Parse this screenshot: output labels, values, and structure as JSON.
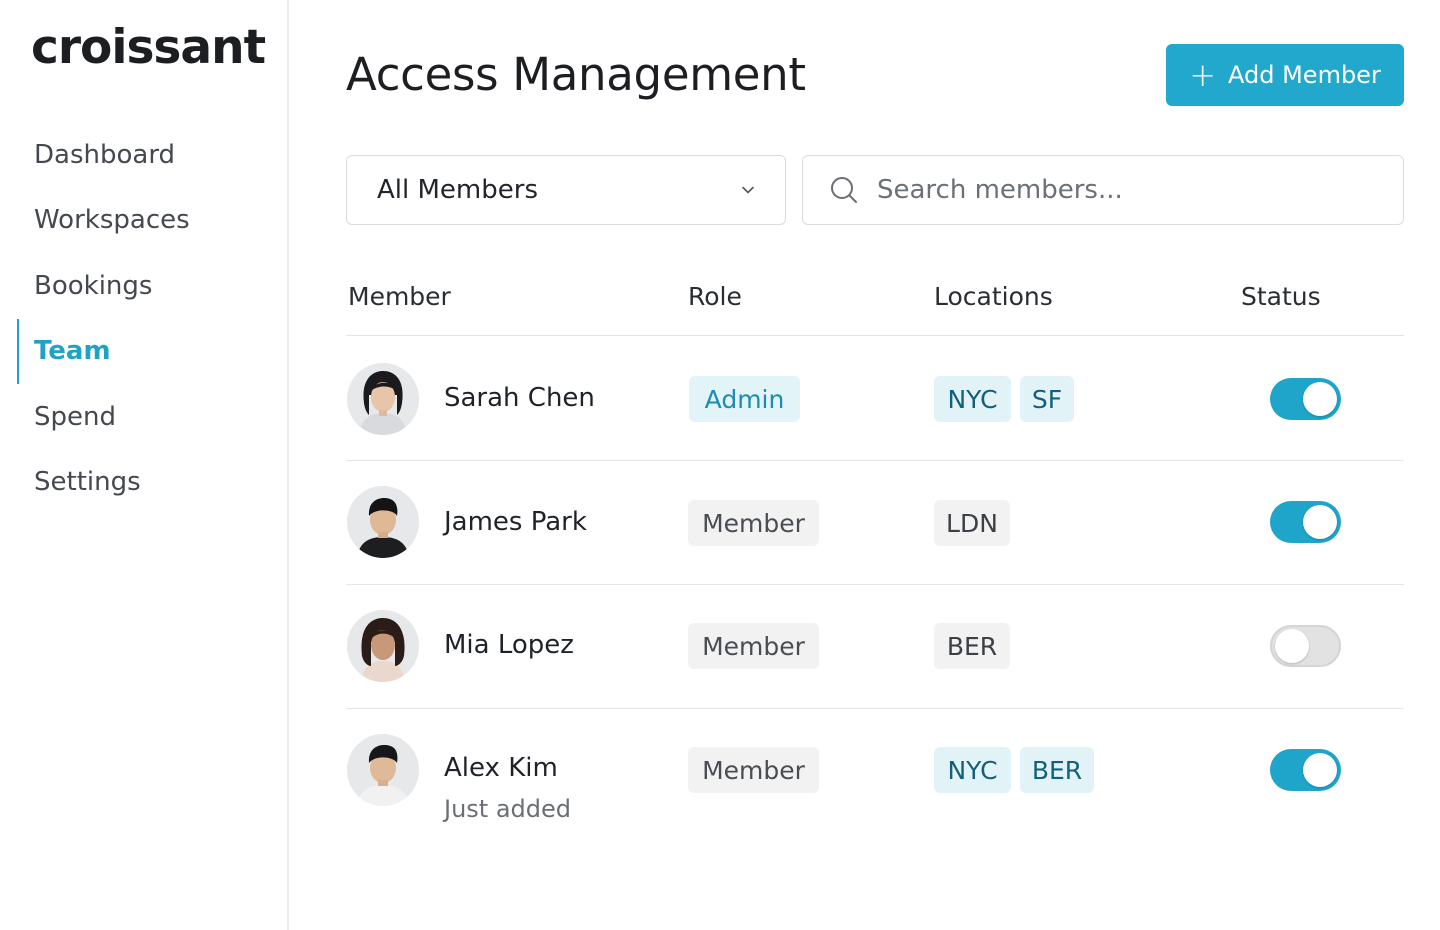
{
  "app": {
    "logo": "croissant"
  },
  "sidebar": {
    "items": [
      {
        "label": "Dashboard",
        "active": false
      },
      {
        "label": "Workspaces",
        "active": false
      },
      {
        "label": "Bookings",
        "active": false
      },
      {
        "label": "Team",
        "active": true
      },
      {
        "label": "Spend",
        "active": false
      },
      {
        "label": "Settings",
        "active": false
      }
    ]
  },
  "header": {
    "title": "Access Management",
    "add_button_label": "Add Member",
    "add_button_icon": "plus-icon"
  },
  "filters": {
    "member_filter": {
      "selected": "All Members",
      "icon": "chevron-down-icon"
    },
    "search": {
      "placeholder": "Search members...",
      "value": "",
      "icon": "search-icon"
    }
  },
  "table": {
    "columns": [
      "Member",
      "Role",
      "Locations",
      "Status"
    ],
    "rows": [
      {
        "name": "Sarah Chen",
        "subtitle": "",
        "role": "Admin",
        "locations": [
          "NYC",
          "SF"
        ],
        "status_on": true
      },
      {
        "name": "James Park",
        "subtitle": "",
        "role": "Member",
        "locations": [
          "LDN"
        ],
        "status_on": true
      },
      {
        "name": "Mia Lopez",
        "subtitle": "",
        "role": "Member",
        "locations": [
          "BER"
        ],
        "status_on": false
      },
      {
        "name": "Alex Kim",
        "subtitle": "Just added",
        "role": "Member",
        "locations": [
          "NYC",
          "BER"
        ],
        "status_on": true
      }
    ]
  },
  "colors": {
    "accent": "#21a8cc",
    "toggle_on": "#1fa5c9",
    "toggle_off": "#e2e2e2",
    "admin_chip_bg": "#e3f4f8",
    "location_chip_bg": "#e2f3f8"
  }
}
